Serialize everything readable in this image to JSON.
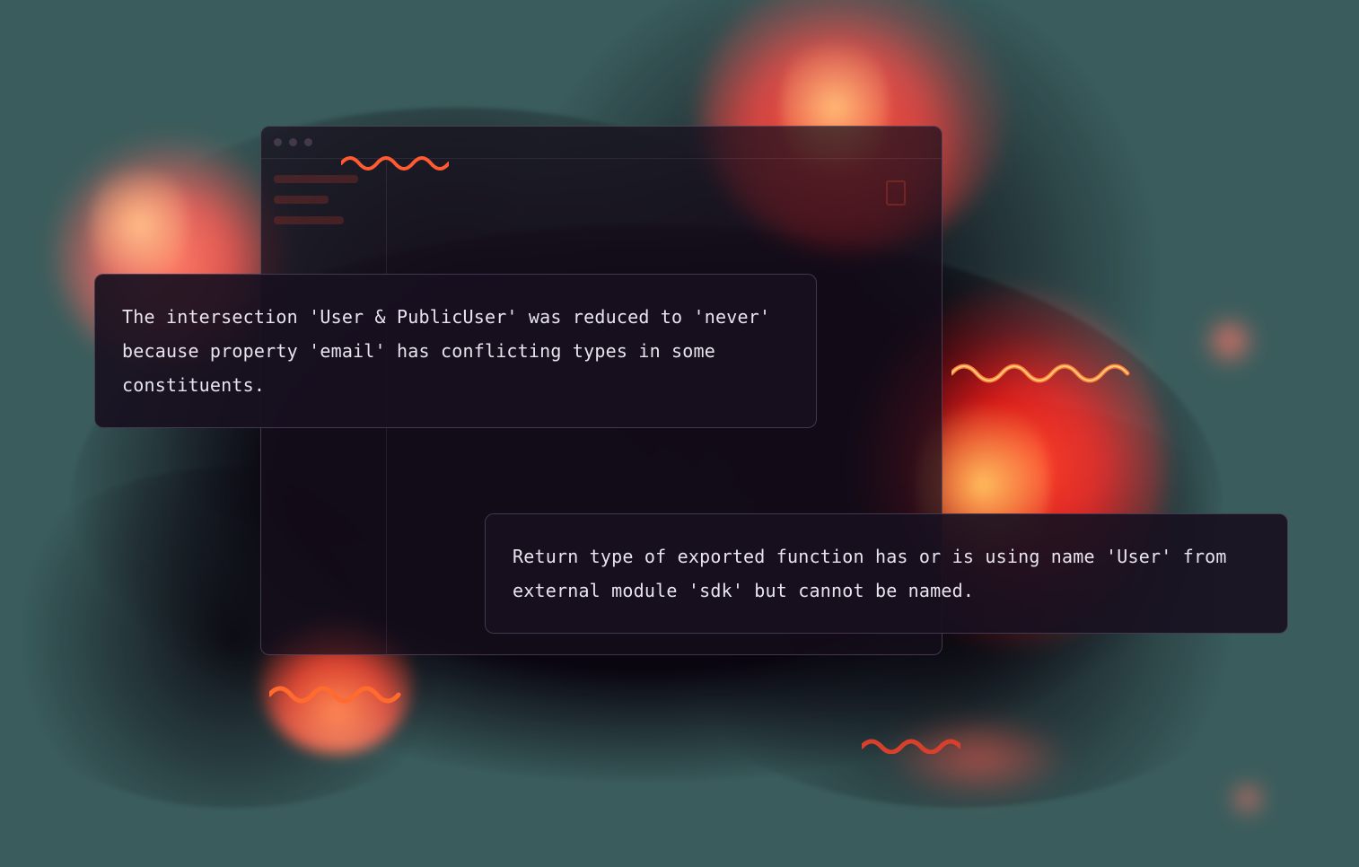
{
  "errors": {
    "intersection": "The intersection 'User & PublicUser' was reduced to 'never' because property 'email' has conflicting types in some constituents.",
    "exported_return": "Return type of exported function has or is using name 'User' from external module 'sdk' but cannot be named."
  },
  "colors": {
    "background": "#3a5c5c",
    "panel_bg": "rgba(24,16,32,0.92)",
    "fire": "#ff2a12",
    "fire_glow": "#ffb347",
    "squiggle": "#e24b2b"
  }
}
